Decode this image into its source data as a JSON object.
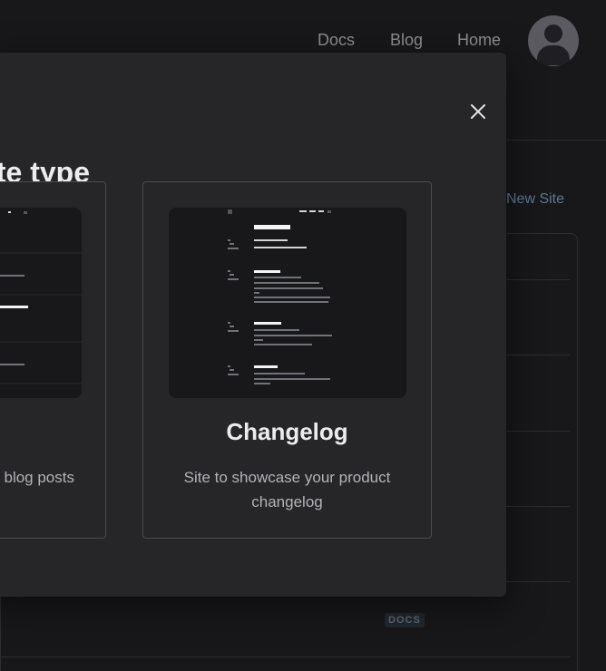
{
  "nav": {
    "links": [
      "Docs",
      "Blog",
      "Home"
    ]
  },
  "background": {
    "new_site_link": "New Site",
    "badge": "DOCS"
  },
  "modal": {
    "title_partial": "te type",
    "cards": [
      {
        "name": "",
        "description": "r blog posts"
      },
      {
        "name": "Changelog",
        "description": "Site to showcase your product changelog"
      }
    ]
  },
  "colors": {
    "page_bg": "#18181a",
    "modal_bg": "#262629",
    "card_border": "#4a4a50",
    "link_muted": "#5c7a94"
  }
}
